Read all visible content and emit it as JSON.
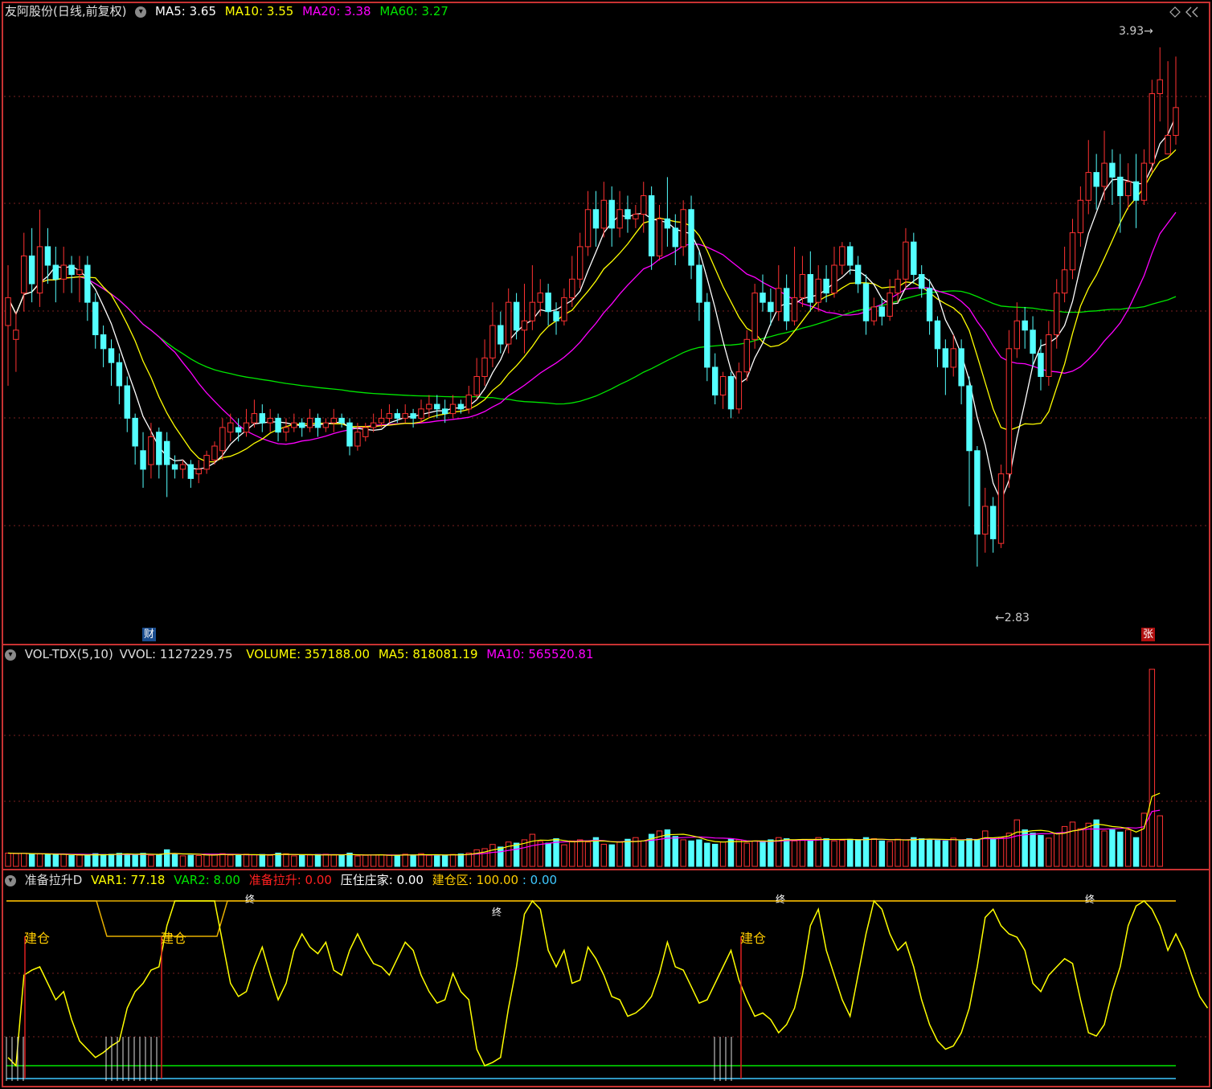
{
  "price_panel": {
    "title": "友阿股份(日线,前复权)",
    "ma5": "MA5: 3.65",
    "ma10": "MA10: 3.55",
    "ma20": "MA20: 3.38",
    "ma60": "MA60: 3.27",
    "high_label": "3.93",
    "low_label": "2.83",
    "tag_cai": "财",
    "tag_zhang": "张"
  },
  "volume_panel": {
    "name": "VOL-TDX(5,10)",
    "vvol": "VVOL: 1127229.75",
    "volume": "VOLUME: 357188.00",
    "ma5": "MA5: 818081.19",
    "ma10": "MA10: 565520.81"
  },
  "indicator_panel": {
    "name": "准备拉升D",
    "var1": "VAR1: 77.18",
    "var2": "VAR2: 8.00",
    "prep": "准备拉升: 0.00",
    "press": "压住庄家: 0.00",
    "jcq": "建仓区: 100.00",
    "extra": ": 0.00",
    "jiancang_label": "建仓",
    "zhong_label": "终"
  },
  "colors": {
    "up": "#ff3232",
    "down": "#54ffff",
    "ma5": "#ffffff",
    "ma10": "#ffff00",
    "ma20": "#ff00ff",
    "ma60": "#00e600",
    "frame": "#c83232",
    "indicator": "#ffff00"
  },
  "chart_data": {
    "type": "candlestick",
    "ylim": [
      2.7,
      4.0
    ],
    "candles": [
      [
        3.35,
        3.41,
        3.48,
        3.22
      ],
      [
        3.32,
        3.34,
        3.38,
        3.25
      ],
      [
        3.42,
        3.5,
        3.55,
        3.38
      ],
      [
        3.5,
        3.44,
        3.56,
        3.4
      ],
      [
        3.42,
        3.52,
        3.6,
        3.39
      ],
      [
        3.52,
        3.48,
        3.56,
        3.44
      ],
      [
        3.48,
        3.45,
        3.52,
        3.4
      ],
      [
        3.45,
        3.48,
        3.52,
        3.42
      ],
      [
        3.48,
        3.46,
        3.5,
        3.42
      ],
      [
        3.46,
        3.47,
        3.5,
        3.4
      ],
      [
        3.48,
        3.4,
        3.5,
        3.36
      ],
      [
        3.4,
        3.33,
        3.42,
        3.3
      ],
      [
        3.33,
        3.3,
        3.35,
        3.26
      ],
      [
        3.3,
        3.27,
        3.32,
        3.22
      ],
      [
        3.27,
        3.22,
        3.29,
        3.18
      ],
      [
        3.22,
        3.15,
        3.24,
        3.12
      ],
      [
        3.15,
        3.09,
        3.16,
        3.05
      ],
      [
        3.08,
        3.04,
        3.12,
        3.0
      ],
      [
        3.05,
        3.11,
        3.14,
        3.02
      ],
      [
        3.12,
        3.05,
        3.13,
        3.02
      ],
      [
        3.1,
        3.05,
        3.12,
        2.98
      ],
      [
        3.05,
        3.04,
        3.07,
        3.02
      ],
      [
        3.04,
        3.05,
        3.06,
        3.02
      ],
      [
        3.05,
        3.02,
        3.06,
        3.0
      ],
      [
        3.03,
        3.04,
        3.06,
        3.01
      ],
      [
        3.04,
        3.07,
        3.08,
        3.03
      ],
      [
        3.06,
        3.09,
        3.1,
        3.05
      ],
      [
        3.08,
        3.13,
        3.15,
        3.06
      ],
      [
        3.12,
        3.14,
        3.16,
        3.1
      ],
      [
        3.13,
        3.12,
        3.15,
        3.1
      ],
      [
        3.12,
        3.14,
        3.17,
        3.11
      ],
      [
        3.14,
        3.16,
        3.19,
        3.13
      ],
      [
        3.16,
        3.14,
        3.18,
        3.12
      ],
      [
        3.14,
        3.15,
        3.17,
        3.12
      ],
      [
        3.15,
        3.12,
        3.16,
        3.1
      ],
      [
        3.12,
        3.13,
        3.15,
        3.1
      ],
      [
        3.13,
        3.14,
        3.16,
        3.12
      ],
      [
        3.14,
        3.13,
        3.15,
        3.11
      ],
      [
        3.13,
        3.15,
        3.17,
        3.12
      ],
      [
        3.15,
        3.13,
        3.16,
        3.11
      ],
      [
        3.13,
        3.14,
        3.15,
        3.12
      ],
      [
        3.14,
        3.15,
        3.17,
        3.12
      ],
      [
        3.15,
        3.14,
        3.16,
        3.13
      ],
      [
        3.14,
        3.09,
        3.15,
        3.07
      ],
      [
        3.09,
        3.12,
        3.14,
        3.08
      ],
      [
        3.11,
        3.13,
        3.14,
        3.1
      ],
      [
        3.13,
        3.14,
        3.16,
        3.12
      ],
      [
        3.14,
        3.15,
        3.17,
        3.13
      ],
      [
        3.15,
        3.16,
        3.18,
        3.14
      ],
      [
        3.16,
        3.15,
        3.17,
        3.14
      ],
      [
        3.15,
        3.16,
        3.18,
        3.14
      ],
      [
        3.16,
        3.15,
        3.17,
        3.13
      ],
      [
        3.15,
        3.17,
        3.19,
        3.14
      ],
      [
        3.17,
        3.18,
        3.2,
        3.15
      ],
      [
        3.18,
        3.17,
        3.2,
        3.15
      ],
      [
        3.17,
        3.16,
        3.19,
        3.14
      ],
      [
        3.16,
        3.18,
        3.2,
        3.15
      ],
      [
        3.18,
        3.17,
        3.19,
        3.16
      ],
      [
        3.17,
        3.2,
        3.22,
        3.16
      ],
      [
        3.2,
        3.24,
        3.28,
        3.19
      ],
      [
        3.24,
        3.28,
        3.32,
        3.22
      ],
      [
        3.28,
        3.35,
        3.4,
        3.26
      ],
      [
        3.35,
        3.31,
        3.38,
        3.29
      ],
      [
        3.31,
        3.4,
        3.43,
        3.29
      ],
      [
        3.4,
        3.34,
        3.42,
        3.32
      ],
      [
        3.34,
        3.36,
        3.44,
        3.29
      ],
      [
        3.36,
        3.4,
        3.48,
        3.34
      ],
      [
        3.4,
        3.42,
        3.45,
        3.37
      ],
      [
        3.42,
        3.38,
        3.44,
        3.35
      ],
      [
        3.38,
        3.36,
        3.4,
        3.33
      ],
      [
        3.36,
        3.41,
        3.43,
        3.35
      ],
      [
        3.41,
        3.45,
        3.5,
        3.39
      ],
      [
        3.45,
        3.52,
        3.55,
        3.43
      ],
      [
        3.52,
        3.6,
        3.64,
        3.5
      ],
      [
        3.6,
        3.56,
        3.64,
        3.52
      ],
      [
        3.56,
        3.62,
        3.66,
        3.54
      ],
      [
        3.62,
        3.56,
        3.65,
        3.52
      ],
      [
        3.56,
        3.6,
        3.64,
        3.54
      ],
      [
        3.6,
        3.58,
        3.63,
        3.55
      ],
      [
        3.58,
        3.59,
        3.61,
        3.56
      ],
      [
        3.59,
        3.63,
        3.66,
        3.55
      ],
      [
        3.63,
        3.5,
        3.65,
        3.47
      ],
      [
        3.5,
        3.58,
        3.61,
        3.49
      ],
      [
        3.58,
        3.56,
        3.67,
        3.52
      ],
      [
        3.56,
        3.52,
        3.59,
        3.48
      ],
      [
        3.52,
        3.6,
        3.62,
        3.5
      ],
      [
        3.6,
        3.48,
        3.63,
        3.45
      ],
      [
        3.48,
        3.4,
        3.51,
        3.36
      ],
      [
        3.4,
        3.26,
        3.42,
        3.23
      ],
      [
        3.26,
        3.2,
        3.29,
        3.18
      ],
      [
        3.2,
        3.24,
        3.25,
        3.17
      ],
      [
        3.24,
        3.17,
        3.25,
        3.15
      ],
      [
        3.17,
        3.25,
        3.27,
        3.16
      ],
      [
        3.25,
        3.32,
        3.34,
        3.23
      ],
      [
        3.32,
        3.42,
        3.44,
        3.3
      ],
      [
        3.42,
        3.4,
        3.46,
        3.38
      ],
      [
        3.4,
        3.38,
        3.43,
        3.35
      ],
      [
        3.38,
        3.43,
        3.48,
        3.36
      ],
      [
        3.43,
        3.36,
        3.46,
        3.34
      ],
      [
        3.36,
        3.41,
        3.52,
        3.35
      ],
      [
        3.41,
        3.46,
        3.5,
        3.39
      ],
      [
        3.46,
        3.4,
        3.51,
        3.38
      ],
      [
        3.4,
        3.45,
        3.48,
        3.38
      ],
      [
        3.45,
        3.42,
        3.48,
        3.4
      ],
      [
        3.42,
        3.48,
        3.52,
        3.41
      ],
      [
        3.48,
        3.52,
        3.53,
        3.46
      ],
      [
        3.52,
        3.48,
        3.53,
        3.46
      ],
      [
        3.48,
        3.44,
        3.5,
        3.42
      ],
      [
        3.44,
        3.36,
        3.46,
        3.33
      ],
      [
        3.36,
        3.39,
        3.41,
        3.35
      ],
      [
        3.39,
        3.37,
        3.41,
        3.35
      ],
      [
        3.37,
        3.42,
        3.45,
        3.36
      ],
      [
        3.42,
        3.45,
        3.47,
        3.4
      ],
      [
        3.45,
        3.53,
        3.56,
        3.43
      ],
      [
        3.53,
        3.46,
        3.55,
        3.44
      ],
      [
        3.46,
        3.43,
        3.48,
        3.41
      ],
      [
        3.43,
        3.36,
        3.45,
        3.33
      ],
      [
        3.36,
        3.3,
        3.37,
        3.26
      ],
      [
        3.3,
        3.26,
        3.32,
        3.2
      ],
      [
        3.26,
        3.3,
        3.33,
        3.24
      ],
      [
        3.3,
        3.22,
        3.32,
        3.18
      ],
      [
        3.22,
        3.08,
        3.24,
        2.96
      ],
      [
        3.08,
        2.9,
        3.09,
        2.83
      ],
      [
        2.9,
        2.96,
        3.0,
        2.86
      ],
      [
        2.96,
        2.89,
        2.98,
        2.86
      ],
      [
        2.88,
        3.03,
        3.05,
        2.87
      ],
      [
        3.03,
        3.3,
        3.34,
        3.0
      ],
      [
        3.3,
        3.36,
        3.4,
        3.28
      ],
      [
        3.36,
        3.34,
        3.39,
        3.3
      ],
      [
        3.34,
        3.29,
        3.37,
        3.26
      ],
      [
        3.29,
        3.24,
        3.32,
        3.21
      ],
      [
        3.24,
        3.33,
        3.36,
        3.22
      ],
      [
        3.33,
        3.42,
        3.45,
        3.3
      ],
      [
        3.42,
        3.47,
        3.52,
        3.4
      ],
      [
        3.47,
        3.55,
        3.58,
        3.45
      ],
      [
        3.55,
        3.62,
        3.65,
        3.52
      ],
      [
        3.62,
        3.68,
        3.75,
        3.59
      ],
      [
        3.68,
        3.65,
        3.72,
        3.6
      ],
      [
        3.65,
        3.7,
        3.77,
        3.62
      ],
      [
        3.7,
        3.67,
        3.73,
        3.61
      ],
      [
        3.67,
        3.63,
        3.72,
        3.55
      ],
      [
        3.63,
        3.66,
        3.7,
        3.6
      ],
      [
        3.66,
        3.62,
        3.72,
        3.56
      ],
      [
        3.62,
        3.7,
        3.73,
        3.61
      ],
      [
        3.7,
        3.85,
        3.88,
        3.68
      ],
      [
        3.85,
        3.88,
        3.95,
        3.79
      ],
      [
        3.72,
        3.76,
        3.92,
        3.72
      ],
      [
        3.76,
        3.82,
        3.93,
        3.74
      ]
    ],
    "volume_ylim": [
      0,
      1800000
    ],
    "volumes": [
      120,
      115,
      118,
      110,
      112,
      108,
      105,
      110,
      98,
      102,
      100,
      115,
      108,
      110,
      118,
      112,
      102,
      118,
      100,
      108,
      150,
      110,
      95,
      100,
      98,
      112,
      108,
      115,
      102,
      98,
      110,
      104,
      108,
      100,
      120,
      114,
      95,
      100,
      102,
      108,
      110,
      102,
      98,
      120,
      94,
      100,
      102,
      105,
      100,
      98,
      110,
      104,
      115,
      100,
      96,
      102,
      108,
      112,
      120,
      150,
      160,
      198,
      175,
      220,
      210,
      240,
      290,
      225,
      210,
      250,
      195,
      230,
      240,
      220,
      260,
      200,
      195,
      220,
      245,
      260,
      230,
      290,
      320,
      330,
      270,
      240,
      230,
      240,
      210,
      200,
      220,
      250,
      240,
      210,
      230,
      220,
      240,
      260,
      250,
      230,
      235,
      240,
      260,
      250,
      230,
      235,
      245,
      240,
      260,
      250,
      230,
      225,
      245,
      240,
      260,
      250,
      240,
      235,
      230,
      255,
      230,
      250,
      240,
      320,
      250,
      260,
      300,
      420,
      330,
      300,
      280,
      255,
      300,
      360,
      400,
      340,
      390,
      420,
      320,
      330,
      310,
      330,
      260,
      480,
      1780,
      457
    ]
  },
  "indicator": {
    "ylim": [
      0,
      100
    ],
    "values": [
      5,
      0,
      55,
      58,
      60,
      50,
      40,
      45,
      28,
      15,
      10,
      5,
      8,
      12,
      15,
      35,
      45,
      50,
      58,
      60,
      85,
      100,
      100,
      100,
      100,
      100,
      100,
      75,
      50,
      42,
      45,
      60,
      72,
      55,
      40,
      50,
      70,
      80,
      72,
      68,
      75,
      58,
      55,
      70,
      80,
      70,
      62,
      60,
      55,
      65,
      75,
      70,
      55,
      45,
      38,
      40,
      56,
      45,
      40,
      10,
      0,
      2,
      5,
      35,
      60,
      92,
      100,
      95,
      70,
      60,
      70,
      50,
      52,
      72,
      65,
      55,
      42,
      40,
      30,
      32,
      36,
      42,
      56,
      75,
      60,
      58,
      48,
      38,
      40,
      50,
      60,
      70,
      52,
      40,
      30,
      32,
      28,
      20,
      25,
      35,
      55,
      85,
      95,
      70,
      55,
      40,
      30,
      55,
      80,
      100,
      95,
      80,
      70,
      75,
      60,
      40,
      25,
      15,
      10,
      12,
      20,
      35,
      60,
      90,
      95,
      85,
      80,
      78,
      70,
      50,
      45,
      55,
      60,
      65,
      62,
      40,
      20,
      18,
      25,
      45,
      60,
      85,
      97,
      100,
      95,
      85,
      70,
      80,
      70,
      55,
      42,
      35
    ]
  }
}
